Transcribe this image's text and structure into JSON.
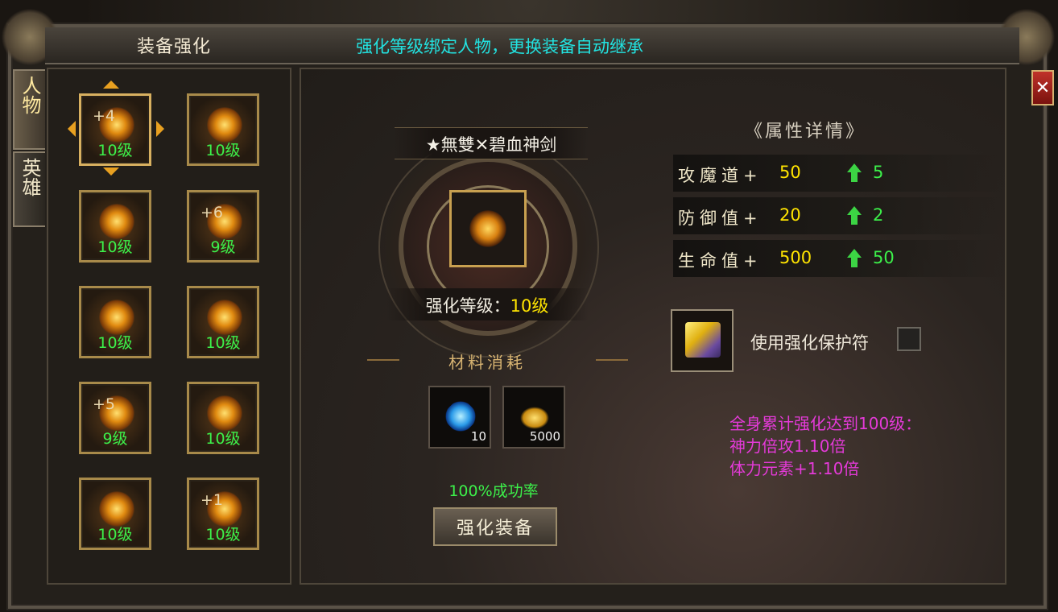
{
  "window": {
    "title": "装备强化",
    "notice": "强化等级绑定人物，更换装备自动继承",
    "close_label": "✕"
  },
  "tabs": [
    {
      "label": "人物",
      "active": true
    },
    {
      "label": "英雄",
      "active": false
    }
  ],
  "equipment_slots": [
    {
      "plus": "+4",
      "level": "10级",
      "selected": true
    },
    {
      "plus": "",
      "level": "10级"
    },
    {
      "plus": "",
      "level": "10级"
    },
    {
      "plus": "+6",
      "level": "9级"
    },
    {
      "plus": "",
      "level": "10级"
    },
    {
      "plus": "",
      "level": "10级"
    },
    {
      "plus": "+5",
      "level": "9级"
    },
    {
      "plus": "",
      "level": "10级"
    },
    {
      "plus": "",
      "level": "10级"
    },
    {
      "plus": "+1",
      "level": "10级"
    }
  ],
  "selected_item": {
    "name": "★無雙✕碧血神剑",
    "level_label": "强化等级：",
    "level_value": "10级"
  },
  "materials": {
    "title": "材料消耗",
    "items": [
      {
        "icon": "blue-crystal-icon",
        "qty": "10"
      },
      {
        "icon": "gold-ingot-icon",
        "qty": "5000"
      }
    ]
  },
  "success_rate": "100%成功率",
  "enhance_button": "强化装备",
  "attributes": {
    "title": "《属性详情》",
    "rows": [
      {
        "name": "攻魔道+",
        "value": "50",
        "gain": "5"
      },
      {
        "name": "防御值+",
        "value": "20",
        "gain": "2"
      },
      {
        "name": "生命值+",
        "value": "500",
        "gain": "50"
      }
    ]
  },
  "protection": {
    "label": "使用强化保护符",
    "checked": false
  },
  "bonus": {
    "line1": "全身累计强化达到100级：",
    "line2": "神力倍攻1.10倍",
    "line3": "体力元素+1.10倍"
  },
  "colors": {
    "level_green": "#3cf04a",
    "value_yellow": "#ffe400",
    "notice_cyan": "#22e2e0",
    "bonus_magenta": "#e43ad8"
  }
}
